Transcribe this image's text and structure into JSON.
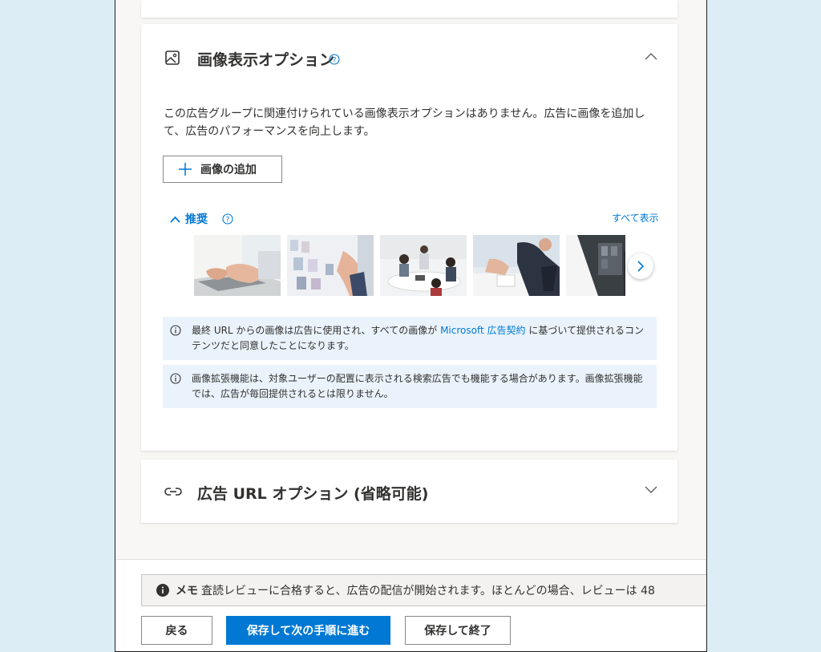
{
  "image_section": {
    "title": "画像表示オプション",
    "description": "この広告グループに関連付けられている画像表示オプションはありません。広告に画像を追加して、広告のパフォーマンスを向上します。",
    "add_button_label": "画像の追加",
    "recommended_label": "推奨",
    "show_all_label": "すべて表示",
    "thumbnails": [
      "typing-laptop",
      "office-wall-notes",
      "team-meeting",
      "business-men-desk",
      "dark-office"
    ],
    "info_notes": [
      {
        "text_before": "最終 URL からの画像は広告に使用され、すべての画像が ",
        "link": "Microsoft 広告契約",
        "text_after": " に基づいて提供されるコンテンツだと同意したことになります。"
      },
      {
        "text_before": "画像拡張機能は、対象ユーザーの配置に表示される検索広告でも機能する場合があります。画像拡張機能では、広告が毎回提供されるとは限りません。",
        "link": "",
        "text_after": ""
      }
    ]
  },
  "url_section": {
    "title": "広告 URL オプション (省略可能)"
  },
  "footer": {
    "memo_label": "メモ",
    "memo_text": "査読レビューに合格すると、広告の配信が開始されます。ほとんどの場合、レビューは 48",
    "back_label": "戻る",
    "save_next_label": "保存して次の手順に進む",
    "save_exit_label": "保存して終了"
  },
  "colors": {
    "accent": "#0078d4",
    "info_bg": "#eaf3fb",
    "page_bg": "#dcedf5"
  },
  "icons": [
    "image-icon",
    "help-icon",
    "chevron-up-icon",
    "plus-icon",
    "chevron-down-icon",
    "chevron-right-icon",
    "info-icon",
    "link-icon"
  ]
}
